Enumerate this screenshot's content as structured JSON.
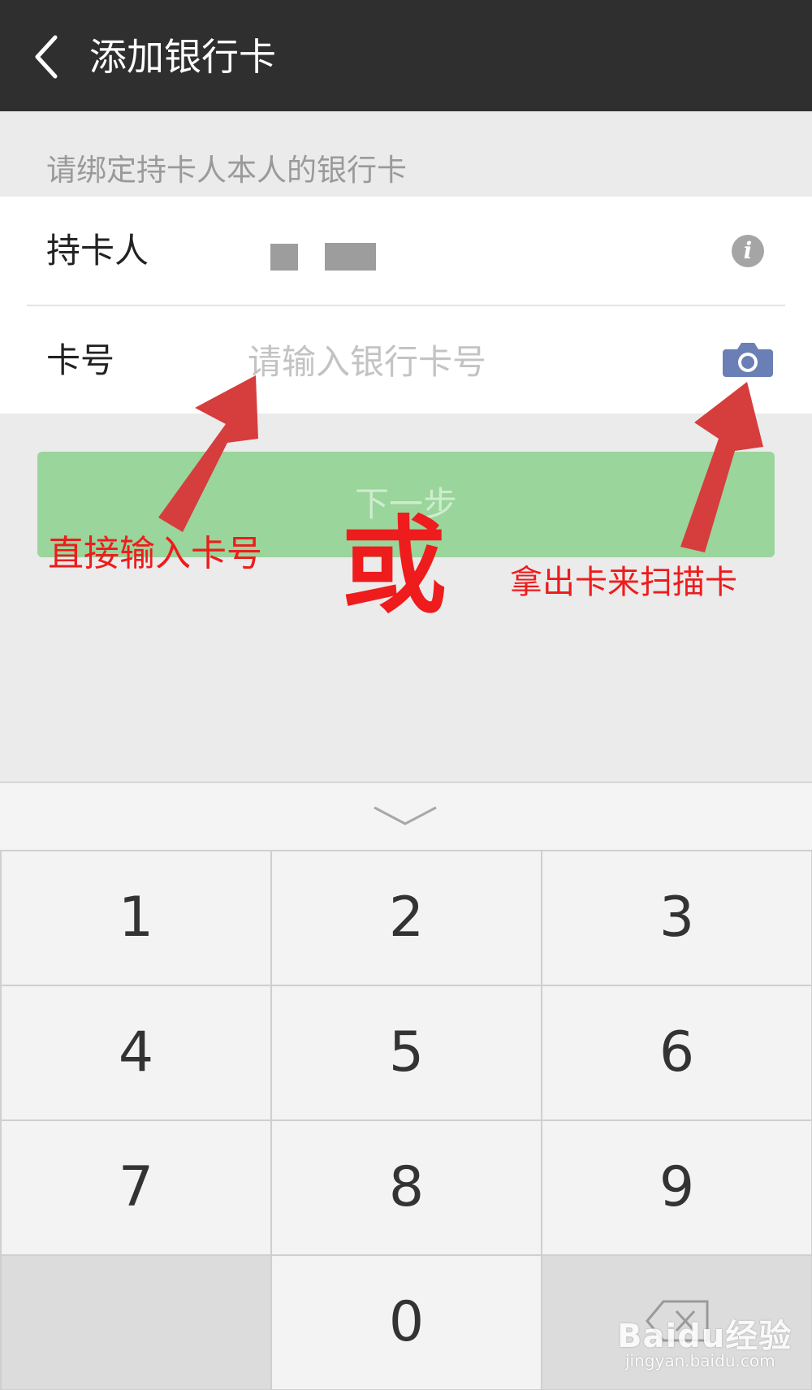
{
  "header": {
    "title": "添加银行卡"
  },
  "hint": "请绑定持卡人本人的银行卡",
  "form": {
    "holder_label": "持卡人",
    "card_label": "卡号",
    "card_placeholder": "请输入银行卡号"
  },
  "next_button": "下一步",
  "annotations": {
    "left": "直接输入卡号",
    "or": "或",
    "right": "拿出卡来扫描卡"
  },
  "keypad": {
    "keys": [
      "1",
      "2",
      "3",
      "4",
      "5",
      "6",
      "7",
      "8",
      "9",
      "",
      "0",
      ""
    ]
  },
  "watermark": {
    "brand": "Baidu经验",
    "url": "jingyan.baidu.com"
  },
  "colors": {
    "header": "#2f2f2f",
    "button": "#9ad59b",
    "annotation": "#ee1c1c",
    "camera": "#6a7fb5"
  },
  "icons": [
    "back-arrow-icon",
    "info-icon",
    "camera-icon",
    "keyboard-collapse-icon",
    "backspace-icon"
  ]
}
